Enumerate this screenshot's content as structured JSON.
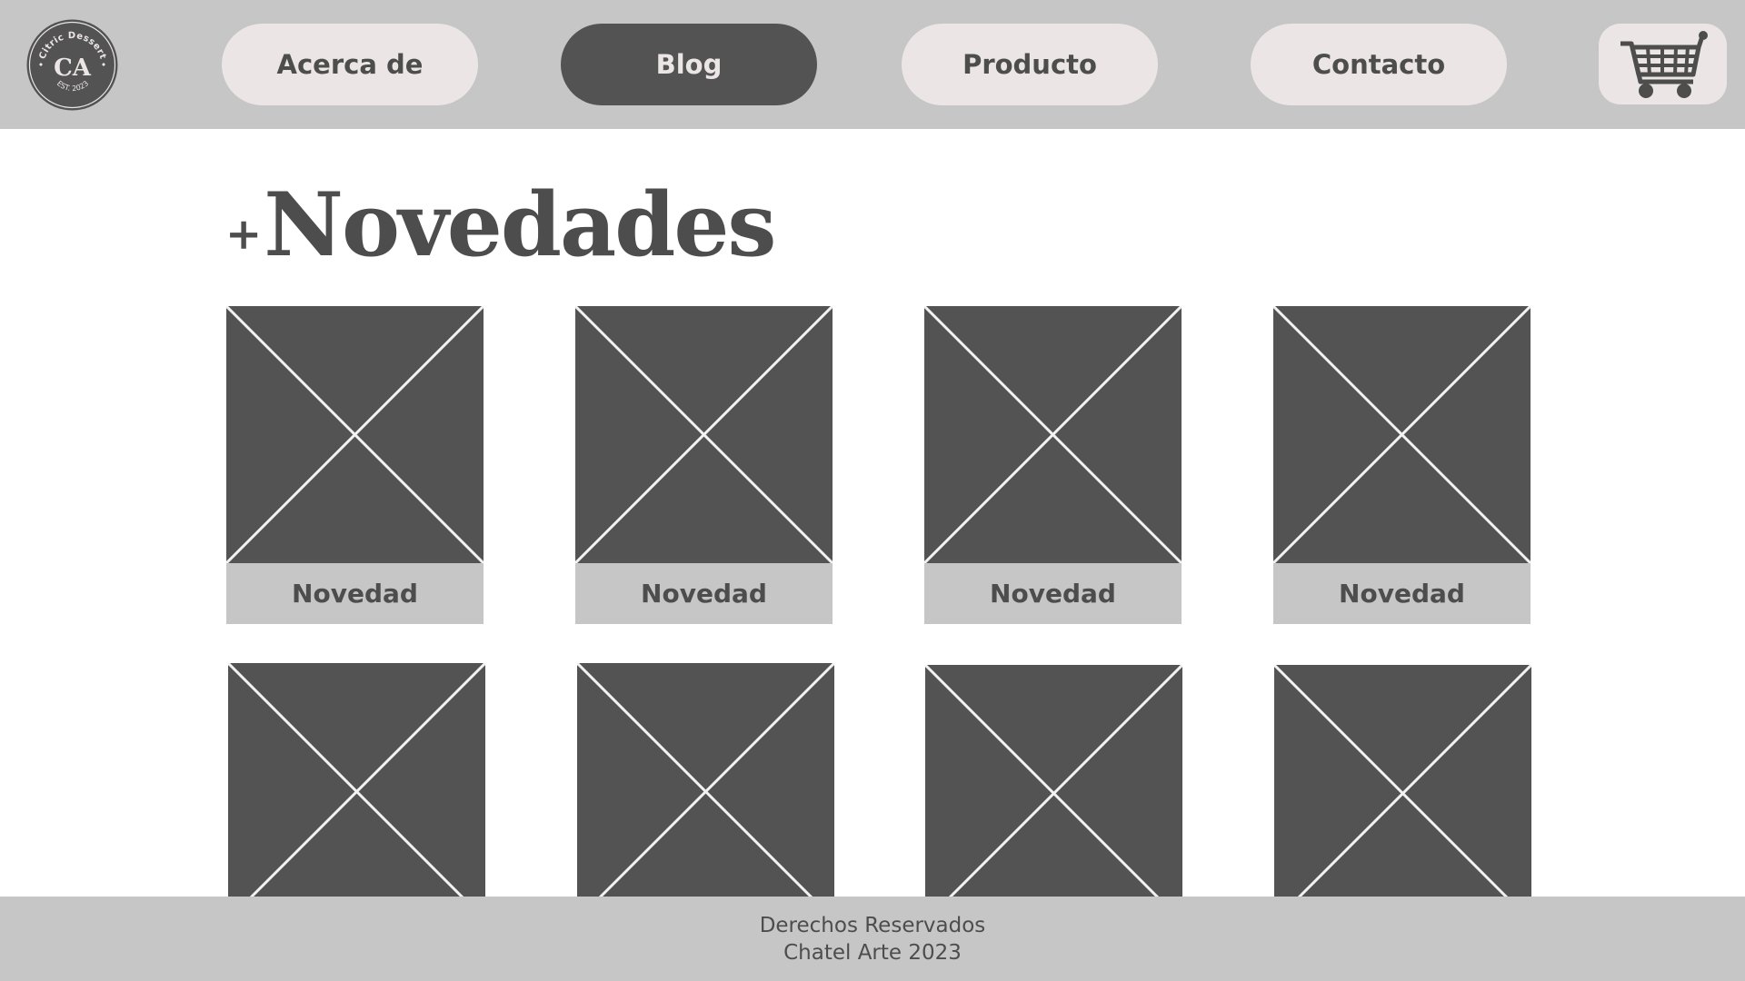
{
  "brand": {
    "arc_text": "Citric Dessert",
    "monogram": "CA",
    "est_text": "EST. 2023"
  },
  "nav": {
    "items": [
      {
        "label": "Acerca de",
        "active": false
      },
      {
        "label": "Blog",
        "active": true
      },
      {
        "label": "Producto",
        "active": false
      },
      {
        "label": "Contacto",
        "active": false
      }
    ],
    "cart_icon": "shopping-cart-icon"
  },
  "main": {
    "title_prefix": "+",
    "title": "Novedades",
    "cards_row1": [
      {
        "label": "Novedad",
        "icon": "image-placeholder-icon"
      },
      {
        "label": "Novedad",
        "icon": "image-placeholder-icon"
      },
      {
        "label": "Novedad",
        "icon": "image-placeholder-icon"
      },
      {
        "label": "Novedad",
        "icon": "image-placeholder-icon"
      }
    ],
    "cards_row2": [
      {
        "icon": "image-placeholder-icon"
      },
      {
        "icon": "image-placeholder-icon"
      },
      {
        "icon": "image-placeholder-icon"
      },
      {
        "icon": "image-placeholder-icon"
      }
    ]
  },
  "footer": {
    "line1": "Derechos Reservados",
    "line2": "Chatel Arte 2023"
  },
  "colors": {
    "header_bg": "#c6c6c6",
    "pill_bg": "#ebe6e5",
    "active_pill_bg": "#535353",
    "text": "#4d4d4d",
    "placeholder": "#535353"
  }
}
